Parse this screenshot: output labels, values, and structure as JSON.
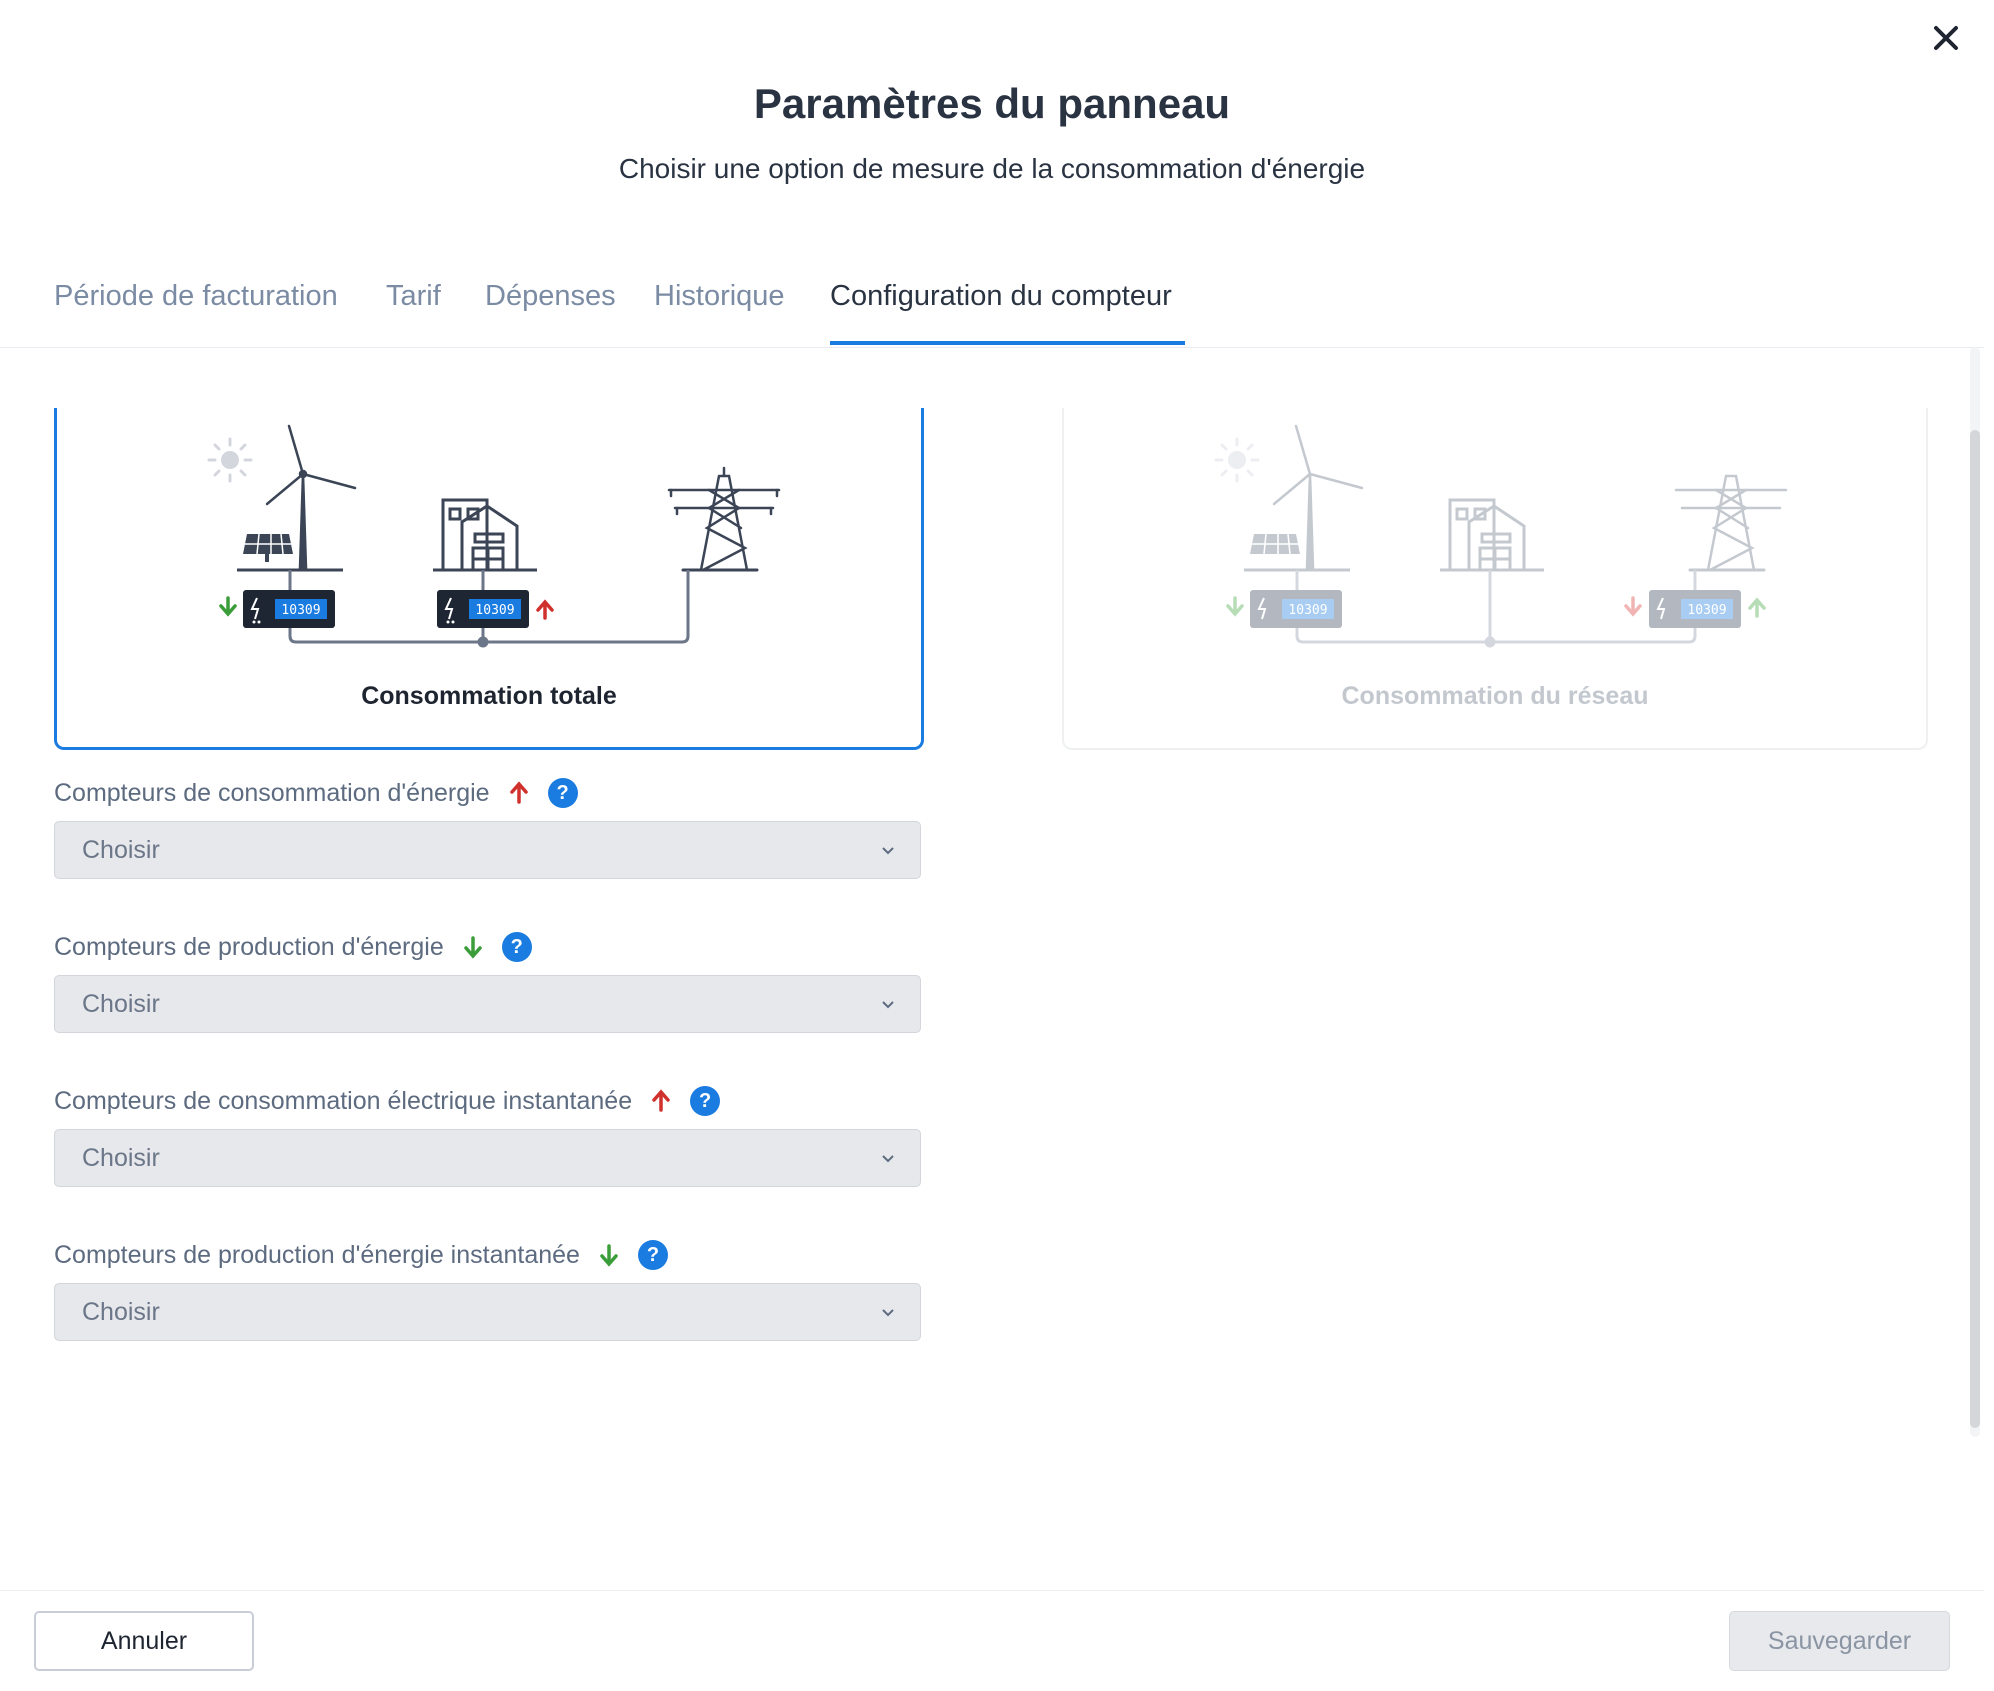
{
  "header": {
    "title": "Paramètres du panneau",
    "subtitle": "Choisir une option de mesure de la consommation d'énergie"
  },
  "tabs": [
    {
      "label": "Période de facturation",
      "active": false
    },
    {
      "label": "Tarif",
      "active": false
    },
    {
      "label": "Dépenses",
      "active": false
    },
    {
      "label": "Historique",
      "active": false
    },
    {
      "label": "Configuration du compteur",
      "active": true
    }
  ],
  "options": [
    {
      "label": "Consommation totale",
      "meter_value": "10309",
      "selected": true
    },
    {
      "label": "Consommation du réseau",
      "meter_value": "10309",
      "selected": false
    }
  ],
  "fields": [
    {
      "label": "Compteurs de consommation d'énergie",
      "direction": "up",
      "help": "?",
      "value": "Choisir"
    },
    {
      "label": "Compteurs de production d'énergie",
      "direction": "down",
      "help": "?",
      "value": "Choisir"
    },
    {
      "label": "Compteurs de consommation électrique instantanée",
      "direction": "up",
      "help": "?",
      "value": "Choisir"
    },
    {
      "label": "Compteurs de production d'énergie instantanée",
      "direction": "down",
      "help": "?",
      "value": "Choisir"
    }
  ],
  "footer": {
    "cancel_label": "Annuler",
    "save_label": "Sauvegarder"
  },
  "colors": {
    "accent": "#1a7be0",
    "up_arrow": "#d0312d",
    "down_arrow": "#3a9d3a",
    "dark_ink": "#2f3848",
    "meter_screen": "#1a7be0"
  }
}
